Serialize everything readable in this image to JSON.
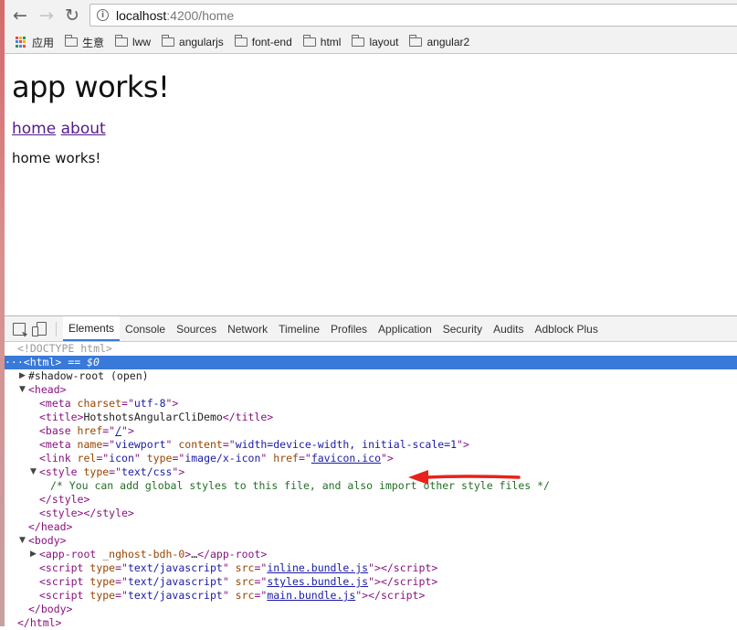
{
  "browser": {
    "url_host": "localhost",
    "url_rest": ":4200/home",
    "bookmarks": {
      "apps_label": "应用",
      "folders": [
        "生意",
        "lww",
        "angularjs",
        "font-end",
        "html",
        "layout",
        "angular2"
      ]
    }
  },
  "page": {
    "heading": "app works!",
    "links": [
      "home",
      "about"
    ],
    "content": "home works!"
  },
  "devtools": {
    "tabs": [
      "Elements",
      "Console",
      "Sources",
      "Network",
      "Timeline",
      "Profiles",
      "Application",
      "Security",
      "Audits",
      "Adblock Plus"
    ],
    "active_tab": "Elements",
    "tree": {
      "doctype": "<!DOCTYPE html>",
      "html_open": "<html>",
      "selected_marker": "== $0",
      "shadow_root": "#shadow-root (open)",
      "head_open": "<head>",
      "meta_charset": {
        "attr": "charset",
        "val": "utf-8"
      },
      "title_text": "HotshotsAngularCliDemo",
      "base_href": "/",
      "meta_viewport": {
        "name": "viewport",
        "content": "width=device-width, initial-scale=1"
      },
      "link_icon": {
        "rel": "icon",
        "type": "image/x-icon",
        "href": "favicon.ico"
      },
      "style_type": "text/css",
      "style_comment": "/* You can add global styles to this file, and also import other style files */",
      "body_open": "<body>",
      "app_root": "_nghost-bdh-0",
      "scripts": [
        "inline.bundle.js",
        "styles.bundle.js",
        "main.bundle.js"
      ],
      "script_type": "text/javascript"
    }
  }
}
